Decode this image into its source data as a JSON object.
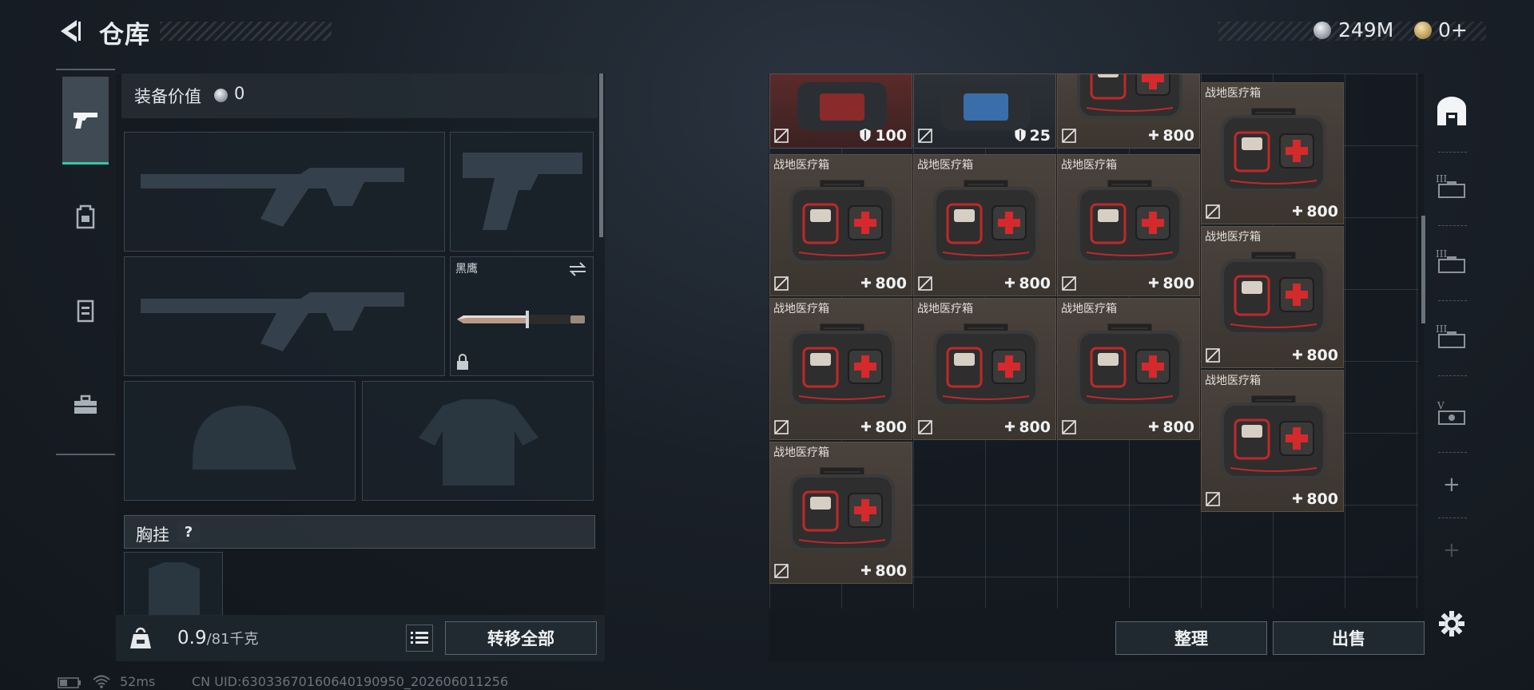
{
  "header": {
    "title": "仓库",
    "currencies": [
      {
        "icon": "silver-coin-icon",
        "amount": "249M"
      },
      {
        "icon": "gold-coin-icon",
        "amount": "0+"
      }
    ]
  },
  "left_tabs": [
    {
      "icon": "pistol-icon",
      "active": true
    },
    {
      "icon": "backpack-icon",
      "active": false
    },
    {
      "icon": "vest-icon",
      "active": false
    },
    {
      "icon": "toolbox-icon",
      "active": false
    }
  ],
  "equipment": {
    "value_label": "装备价值",
    "value": "0",
    "melee_name": "黑鹰",
    "vest_label": "胸挂",
    "help_label": "?"
  },
  "weight": {
    "current": "0.9",
    "max": "/81千克"
  },
  "buttons": {
    "transfer_all": "转移全部",
    "arrange": "整理",
    "sell": "出售"
  },
  "storage": {
    "partial_top": [
      {
        "value": "100",
        "value_icon": "armor-icon",
        "tone": "red"
      },
      {
        "value": "25",
        "value_icon": "armor-icon",
        "tone": "dark"
      },
      {
        "value": "800",
        "value_icon": "plus-icon",
        "tone": "brown"
      }
    ],
    "items": [
      {
        "name": "战地医疗箱",
        "value": "800"
      },
      {
        "name": "战地医疗箱",
        "value": "800"
      },
      {
        "name": "战地医疗箱",
        "value": "800"
      },
      {
        "name": "战地医疗箱",
        "value": "800"
      },
      {
        "name": "战地医疗箱",
        "value": "800"
      },
      {
        "name": "战地医疗箱",
        "value": "800"
      },
      {
        "name": "战地医疗箱",
        "value": "800"
      },
      {
        "name": "战地医疗箱",
        "value": "800"
      },
      {
        "name": "战地医疗箱",
        "value": "800"
      },
      {
        "name": "战地医疗箱",
        "value": "800"
      }
    ]
  },
  "right_rail": [
    {
      "icon": "storage-arch-icon",
      "active": true
    },
    {
      "icon": "case-III-icon",
      "label": "III"
    },
    {
      "icon": "case-III-icon",
      "label": "III"
    },
    {
      "icon": "case-III-icon",
      "label": "III"
    },
    {
      "icon": "case-V-icon",
      "label": "V"
    }
  ],
  "status": {
    "ping": "52ms",
    "uid": "CN UID:63033670160640190950_202606011256"
  }
}
